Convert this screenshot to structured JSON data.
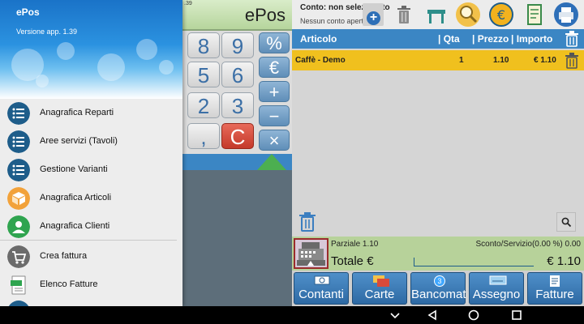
{
  "drawer": {
    "app_name": "ePos",
    "version": "Versione app. 1.39",
    "items": [
      {
        "label": "Anagrafica Reparti",
        "icon": "list-icon",
        "color": "#1e5d8a"
      },
      {
        "label": "Aree servizi (Tavoli)",
        "icon": "list-icon",
        "color": "#1e5d8a"
      },
      {
        "label": "Gestione Varianti",
        "icon": "list-icon",
        "color": "#1e5d8a"
      },
      {
        "label": "Anagrafica Articoli",
        "icon": "box-icon",
        "color": "#f2a23a"
      },
      {
        "label": "Anagrafica Clienti",
        "icon": "person-icon",
        "color": "#2fa44f"
      },
      {
        "label": "Crea fattura",
        "icon": "cart-icon",
        "color": "#6b6b6b"
      },
      {
        "label": "Elenco Fatture",
        "icon": "xml-file-icon",
        "color": "#1e5d8a"
      }
    ]
  },
  "calculator": {
    "display_title": "ePos",
    "display_small": ".39",
    "keys": [
      "8",
      "9",
      "5",
      "6",
      "2",
      "3",
      ",",
      "C"
    ],
    "ops": [
      "%",
      "€",
      "+",
      "−",
      "×"
    ]
  },
  "topbar": {
    "conto_label": "Conto: non selezionato",
    "conto_sub": "Nessun conto aperto",
    "add_symbol": "+"
  },
  "table": {
    "headers": {
      "articolo": "Articolo",
      "qta": "| Qta",
      "prezzo": "| Prezzo",
      "importo": "| Importo"
    },
    "rows": [
      {
        "articolo": "Caffè - Demo",
        "qta": "1",
        "prezzo": "1.10",
        "importo": "€ 1.10"
      }
    ]
  },
  "totals": {
    "parziale": "Parziale 1.10",
    "sconto": "Sconto/Servizio(0.00 %) 0.00",
    "totale_label": "Totale €",
    "totale_value": "€ 1.10"
  },
  "payments": [
    {
      "label": "Contanti"
    },
    {
      "label": "Carte"
    },
    {
      "label": "Bancomat",
      "badge": "3"
    },
    {
      "label": "Assegno"
    },
    {
      "label": "Fatture"
    }
  ],
  "colors": {
    "accent": "#3b86c4",
    "row_highlight": "#f0c01e",
    "totals_bg": "#b7d29a"
  }
}
